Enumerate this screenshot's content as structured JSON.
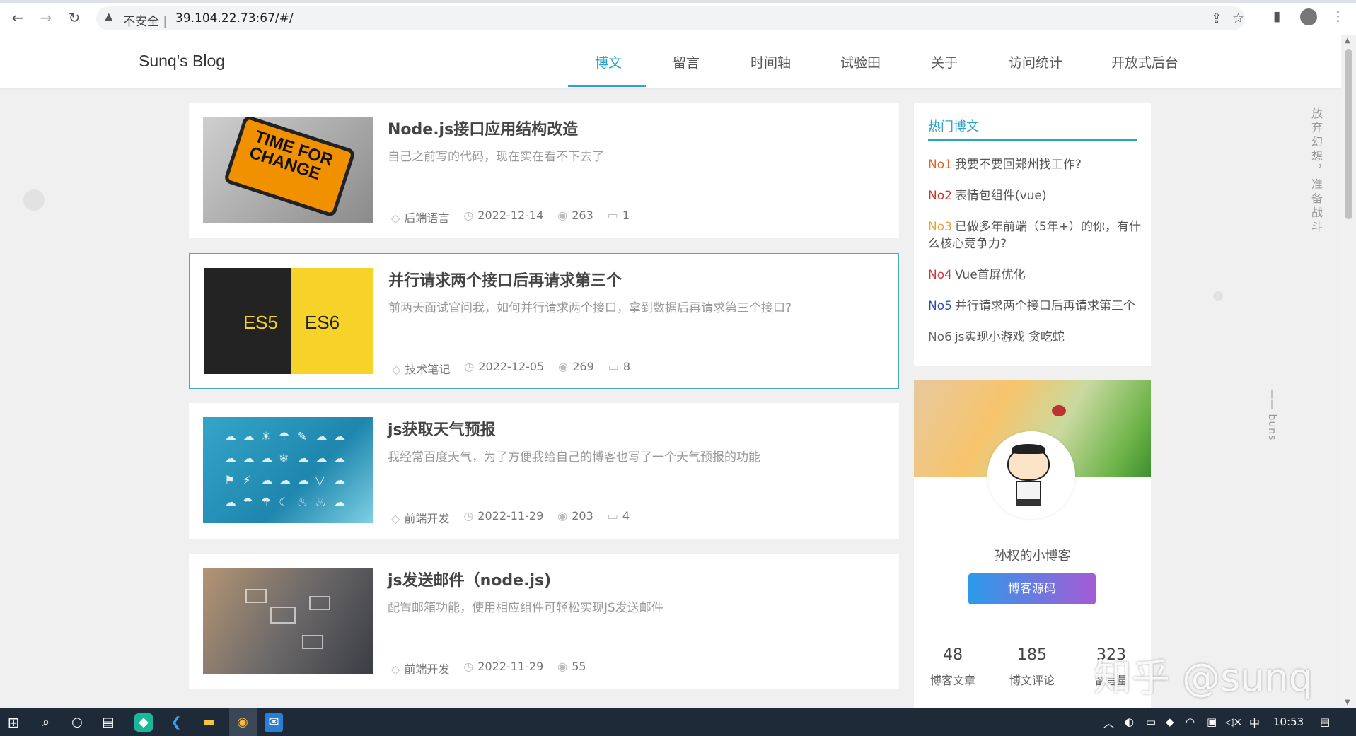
{
  "browser": {
    "insecure_label": "不安全",
    "separator": "|",
    "url": "39.104.22.73:67/#/",
    "icons": [
      "back-icon",
      "forward-icon",
      "reload-icon",
      "warning-icon",
      "share-icon",
      "star-icon",
      "sidepanel-icon",
      "profile-icon",
      "menu-icon"
    ]
  },
  "site": {
    "title": "Sunq's Blog",
    "nav": [
      "博文",
      "留言",
      "时间轴",
      "试验田",
      "关于",
      "访问统计",
      "开放式后台"
    ],
    "active_nav": "博文",
    "accent": "#2ba4c8"
  },
  "articles": [
    {
      "title": "Node.js接口应用结构改造",
      "desc": "自己之前写的代码，现在实在看不下去了",
      "category": "后端语言",
      "date": "2022-12-14",
      "views": "263",
      "comments": "1",
      "thumb_text": "TIME FOR CHANGE"
    },
    {
      "title": "并行请求两个接口后再请求第三个",
      "desc": "前两天面试官问我，如何并行请求两个接口，拿到数据后再请求第三个接口?",
      "category": "技术笔记",
      "date": "2022-12-05",
      "views": "269",
      "comments": "8",
      "thumb_left": "ES5",
      "thumb_right": "ES6"
    },
    {
      "title": "js获取天气预报",
      "desc": "我经常百度天气，为了方便我给自己的博客也写了一个天气预报的功能",
      "category": "前端开发",
      "date": "2022-11-29",
      "views": "203",
      "comments": "4"
    },
    {
      "title": "js发送邮件（node.js)",
      "desc": "配置邮箱功能，使用相应组件可轻松实现JS发送邮件",
      "category": "前端开发",
      "date": "2022-11-29",
      "views": "55"
    }
  ],
  "hot_posts": {
    "title": "热门博文",
    "items": [
      {
        "no": "No1",
        "text": "我要不要回郑州找工作?",
        "color": "#e0632a"
      },
      {
        "no": "No2",
        "text": "表情包组件(vue)",
        "color": "#c0392b"
      },
      {
        "no": "No3",
        "text": "已做多年前端（5年+）的你，有什么核心竞争力?",
        "color": "#e8a23a"
      },
      {
        "no": "No4",
        "text": "Vue首屏优化",
        "color": "#d0323e"
      },
      {
        "no": "No5",
        "text": "并行请求两个接口后再请求第三个",
        "color": "#2d4fa3"
      },
      {
        "no": "No6",
        "text": "js实现小游戏 贪吃蛇",
        "color": "#666666"
      }
    ]
  },
  "profile": {
    "name": "孙权的小博客",
    "source_button": "博客源码",
    "stats": [
      {
        "num": "48",
        "label": "博客文章"
      },
      {
        "num": "185",
        "label": "博文评论"
      },
      {
        "num": "323",
        "label": "留言量"
      }
    ]
  },
  "side_text": {
    "motto": "放弃幻想，准备战斗",
    "sign": "—— buns"
  },
  "watermark": "知乎 @sunq",
  "taskbar": {
    "time": "10:53",
    "ime": "中",
    "icons": [
      "windows-icon",
      "search-icon",
      "cortana-icon",
      "taskview-icon",
      "app-icon",
      "vscode-icon",
      "explorer-icon",
      "chrome-icon",
      "mail-icon"
    ]
  }
}
